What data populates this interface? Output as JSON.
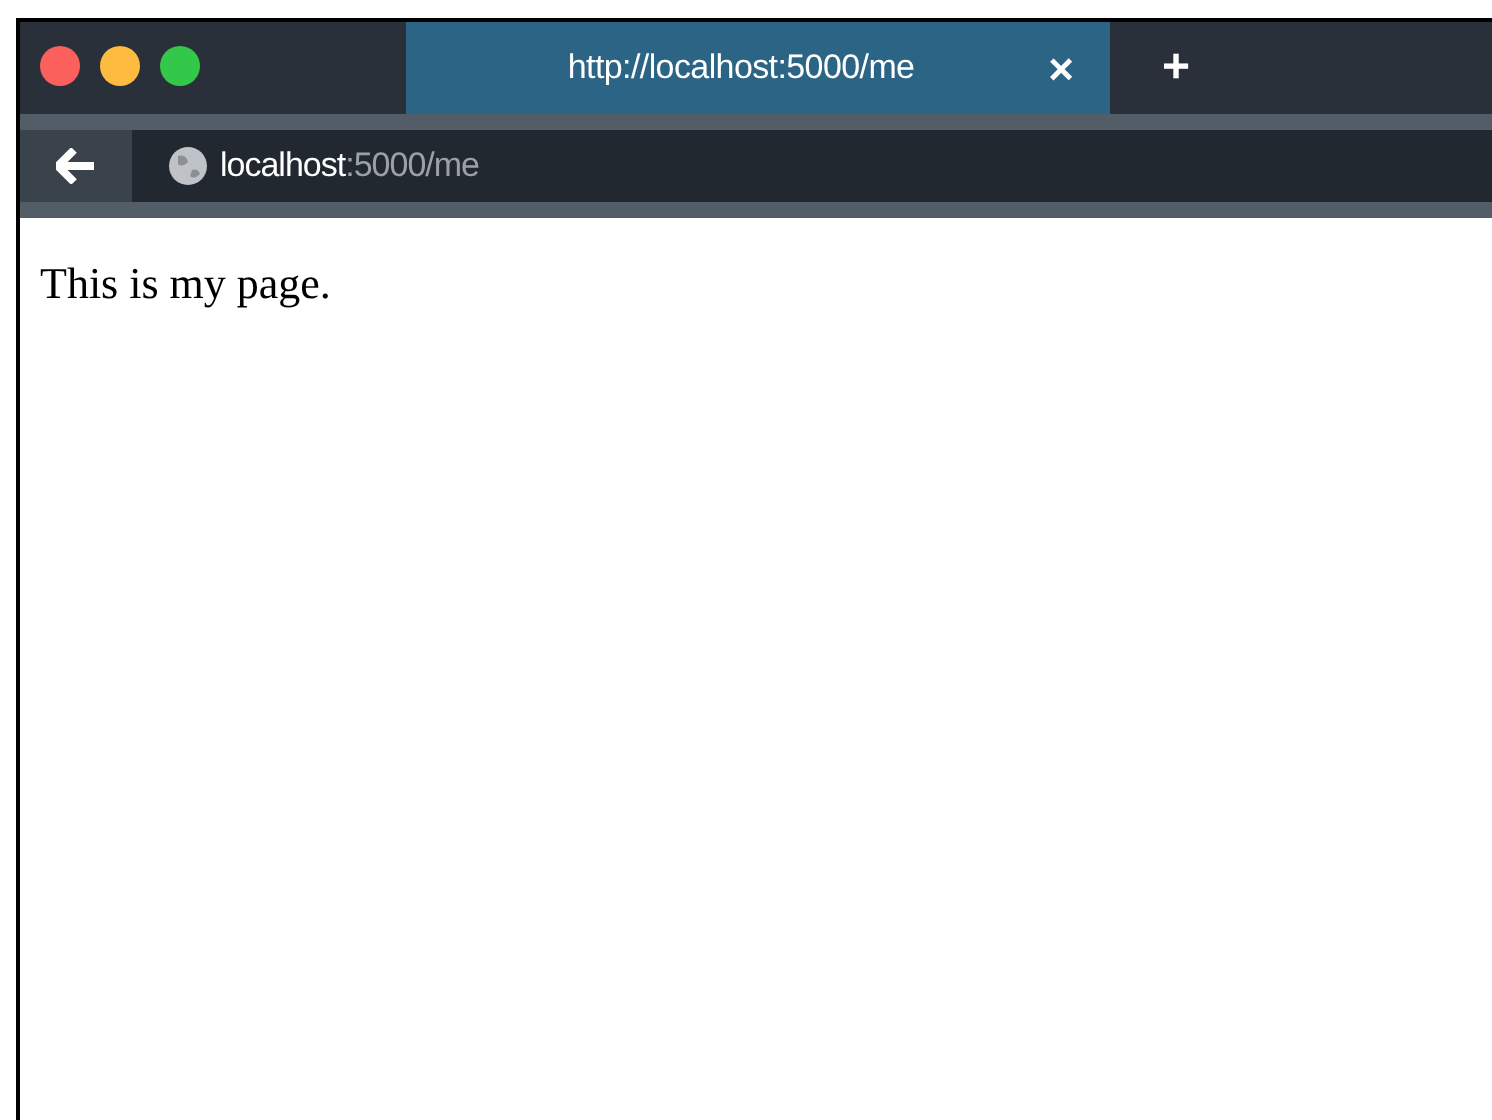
{
  "window": {
    "buttons": [
      {
        "color": "#fc605c"
      },
      {
        "color": "#fdbc40"
      },
      {
        "color": "#34c84a"
      }
    ]
  },
  "tabs": [
    {
      "title": "http://localhost:5000/me",
      "close": "×",
      "selected": true
    }
  ],
  "new_tab": "+",
  "address_bar": {
    "host": "localhost",
    "path": ":5000/me"
  },
  "page": {
    "text": "This is my page."
  }
}
